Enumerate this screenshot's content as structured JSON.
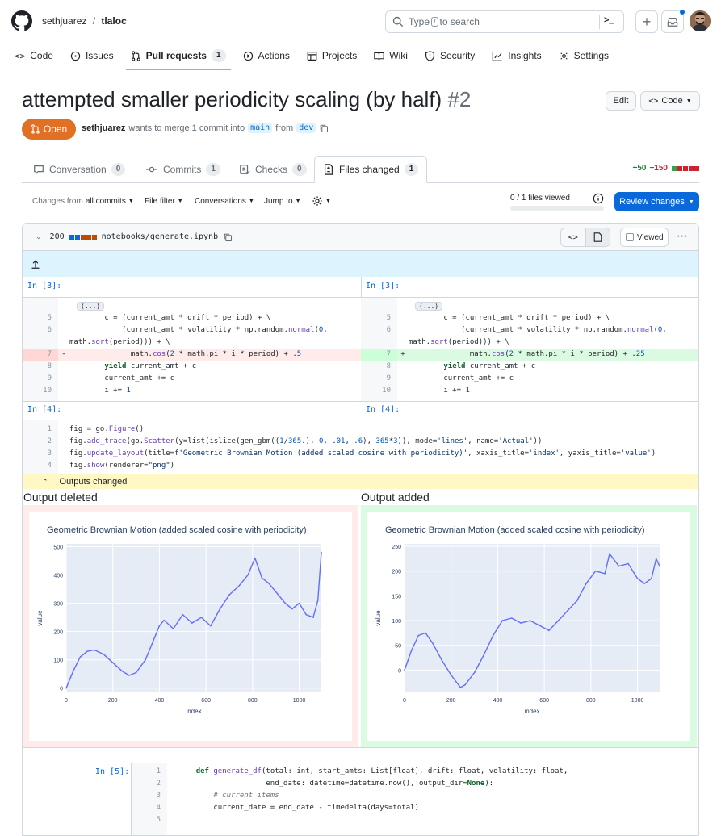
{
  "header": {
    "owner": "sethjuarez",
    "separator": "/",
    "repo": "tlaloc",
    "search_prefix": "Type",
    "search_key": "/",
    "search_suffix": "to search",
    "terminal_label": ">_",
    "plus_label": "+"
  },
  "nav": [
    {
      "label": "Code",
      "icon": "code-icon"
    },
    {
      "label": "Issues",
      "icon": "issue-icon"
    },
    {
      "label": "Pull requests",
      "icon": "pull-request-icon",
      "count": "1",
      "active": true
    },
    {
      "label": "Actions",
      "icon": "play-icon"
    },
    {
      "label": "Projects",
      "icon": "table-icon"
    },
    {
      "label": "Wiki",
      "icon": "book-icon"
    },
    {
      "label": "Security",
      "icon": "shield-icon"
    },
    {
      "label": "Insights",
      "icon": "graph-icon"
    },
    {
      "label": "Settings",
      "icon": "gear-icon"
    }
  ],
  "pr": {
    "title": "attempted smaller periodicity scaling (by half)",
    "number": "#2",
    "edit_label": "Edit",
    "code_label": "Code",
    "status": "Open",
    "author": "sethjuarez",
    "merge_text": "wants to merge 1 commit into",
    "base": "main",
    "from_text": "from",
    "head": "dev"
  },
  "tabs": [
    {
      "label": "Conversation",
      "count": "0"
    },
    {
      "label": "Commits",
      "count": "1"
    },
    {
      "label": "Checks",
      "count": "0"
    },
    {
      "label": "Files changed",
      "count": "1",
      "active": true
    }
  ],
  "diffstat": {
    "added": "+50",
    "removed": "−150"
  },
  "toolbar": {
    "changes_prefix": "Changes from",
    "changes_value": "all commits",
    "file_filter": "File filter",
    "conversations": "Conversations",
    "jump_to": "Jump to",
    "files_viewed": "0 / 1 files viewed",
    "review": "Review changes"
  },
  "file": {
    "changes": "200",
    "path": "notebooks/generate.ipynb",
    "viewed": "Viewed"
  },
  "cells": {
    "in3": "In [3]:",
    "in4": "In [4]:",
    "in5": "In [5]:",
    "ellipsis": "(...)",
    "left_lines": [
      {
        "n": "5",
        "code": "        c = (current_amt * drift * period) + \\"
      },
      {
        "n": "6",
        "code": "            (current_amt * volatility * np.random.normal(0,"
      },
      {
        "n": "",
        "code": "math.sqrt(period))) + \\"
      },
      {
        "n": "7",
        "sign": "-",
        "code": "              math.cos(2 * math.pi * i * period) + .5",
        "type": "del"
      },
      {
        "n": "8",
        "code": "        yield current_amt + c"
      },
      {
        "n": "9",
        "code": "        current_amt += c"
      },
      {
        "n": "10",
        "code": "        i += 1"
      }
    ],
    "right_lines": [
      {
        "n": "5",
        "code": "        c = (current_amt * drift * period) + \\"
      },
      {
        "n": "6",
        "code": "            (current_amt * volatility * np.random.normal(0,"
      },
      {
        "n": "",
        "code": "math.sqrt(period))) + \\"
      },
      {
        "n": "7",
        "sign": "+",
        "code": "              math.cos(2 * math.pi * i * period) + .25",
        "type": "add"
      },
      {
        "n": "8",
        "code": "        yield current_amt + c"
      },
      {
        "n": "9",
        "code": "        current_amt += c"
      },
      {
        "n": "10",
        "code": "        i += 1"
      }
    ],
    "in4_lines": [
      {
        "n": "1",
        "code": "fig = go.Figure()"
      },
      {
        "n": "2",
        "code": "fig.add_trace(go.Scatter(y=list(islice(gen_gbm((1/365.), 0, .01, .6), 365*3)), mode='lines', name='Actual'))"
      },
      {
        "n": "3",
        "code": "fig.update_layout(title=f'Geometric Brownian Motion (added scaled cosine with periodicity)', xaxis_title='index', yaxis_title='value')"
      },
      {
        "n": "4",
        "code": "fig.show(renderer=\"png\")"
      }
    ],
    "in5_lines": [
      {
        "n": "1",
        "code": "    def generate_df(total: int, start_amts: List[float], drift: float, volatility: float,"
      },
      {
        "n": "2",
        "code": "                    end_date: datetime=datetime.now(), output_dir=None):"
      },
      {
        "n": "3",
        "code": "        # current items"
      },
      {
        "n": "4",
        "code": "        current_date = end_date - timedelta(days=total)"
      },
      {
        "n": "5",
        "code": ""
      }
    ]
  },
  "outputs": {
    "bar_label": "Outputs changed",
    "deleted_label": "Output deleted",
    "added_label": "Output added"
  },
  "colors": {
    "accent": "#0969da",
    "open": "#e16f24",
    "deleted_bg": "#ffebe9",
    "added_bg": "#dafbe1",
    "line": "#636efa",
    "plot_bg": "#e5ecf6"
  },
  "chart_data": [
    {
      "type": "line",
      "title": "Geometric Brownian Motion (added scaled cosine with periodicity)",
      "xlabel": "index",
      "ylabel": "value",
      "xlim": [
        0,
        1095
      ],
      "ylim": [
        -15,
        510
      ],
      "xticks": [
        0,
        200,
        400,
        600,
        800,
        1000
      ],
      "yticks": [
        0,
        100,
        200,
        300,
        400,
        500
      ],
      "x": [
        0,
        30,
        60,
        90,
        120,
        160,
        200,
        240,
        270,
        300,
        340,
        380,
        400,
        420,
        460,
        500,
        540,
        580,
        620,
        660,
        700,
        740,
        780,
        810,
        840,
        870,
        900,
        940,
        970,
        1000,
        1030,
        1060,
        1080,
        1095
      ],
      "values": [
        0,
        60,
        110,
        130,
        135,
        120,
        90,
        60,
        45,
        55,
        100,
        180,
        220,
        240,
        210,
        260,
        230,
        250,
        220,
        280,
        330,
        360,
        400,
        460,
        390,
        370,
        340,
        300,
        280,
        300,
        260,
        250,
        310,
        480
      ]
    },
    {
      "type": "line",
      "title": "Geometric Brownian Motion (added scaled cosine with periodicity)",
      "xlabel": "index",
      "ylabel": "value",
      "xlim": [
        0,
        1095
      ],
      "ylim": [
        -45,
        255
      ],
      "xticks": [
        0,
        200,
        400,
        600,
        800,
        1000
      ],
      "yticks": [
        0,
        50,
        100,
        150,
        200,
        250
      ],
      "x": [
        0,
        30,
        60,
        90,
        120,
        160,
        200,
        240,
        260,
        300,
        340,
        380,
        420,
        460,
        500,
        540,
        580,
        620,
        660,
        700,
        740,
        780,
        820,
        860,
        880,
        920,
        960,
        1000,
        1030,
        1060,
        1080,
        1095
      ],
      "values": [
        0,
        40,
        70,
        75,
        55,
        20,
        -10,
        -35,
        -30,
        -5,
        30,
        70,
        100,
        105,
        95,
        100,
        90,
        80,
        100,
        120,
        140,
        175,
        200,
        195,
        235,
        210,
        215,
        185,
        175,
        185,
        225,
        210
      ]
    }
  ]
}
